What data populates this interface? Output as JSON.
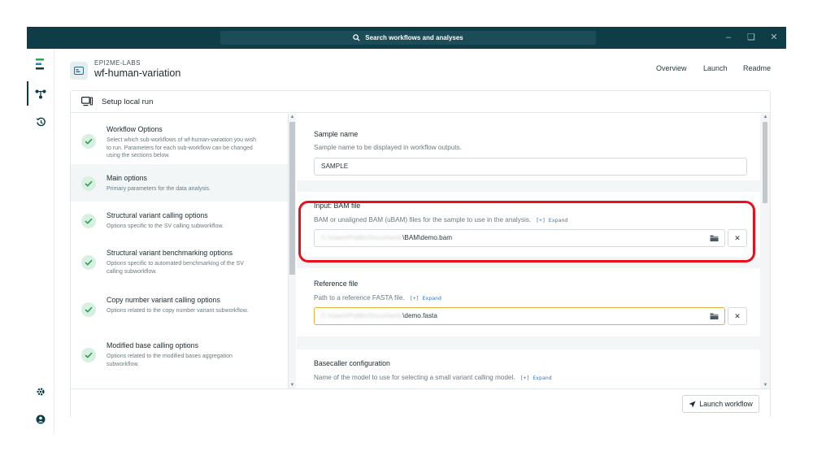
{
  "titlebar": {
    "search_placeholder": "Search workflows and analyses"
  },
  "header": {
    "brand": "EPI2ME-LABS",
    "title": "wf-human-variation",
    "nav": [
      "Overview",
      "Launch",
      "Readme"
    ]
  },
  "card": {
    "title": "Setup local run"
  },
  "steps": [
    {
      "title": "Workflow Options",
      "desc": "Select which sub-workflows of wf-human-variation you wish to run. Parameters for each sub-workflow can be changed using the sections below."
    },
    {
      "title": "Main options",
      "desc": "Primary parameters for the data analysis."
    },
    {
      "title": "Structural variant calling options",
      "desc": "Options specific to the SV calling subworkflow."
    },
    {
      "title": "Structural variant benchmarking options",
      "desc": "Options specific to automated benchmarking of the SV calling subworkflow."
    },
    {
      "title": "Copy number variant calling options",
      "desc": "Options related to the copy number variant subworkflow."
    },
    {
      "title": "Modified base calling options",
      "desc": "Options related to the modified bases aggregation subworkflow."
    }
  ],
  "form": {
    "sample_name": {
      "label": "Sample name",
      "desc": "Sample name to be displayed in workflow outputs.",
      "value": "SAMPLE"
    },
    "bam": {
      "label": "Input: BAM file",
      "desc": "BAM or unaligned BAM (uBAM) files for the sample to use in the analysis.",
      "expand": "[+] Expand",
      "value_hidden": "C:\\Users\\Public\\Documents",
      "value_visible": "\\BAM\\demo.bam"
    },
    "reference": {
      "label": "Reference file",
      "desc": "Path to a reference FASTA file.",
      "expand": "[+] Expand",
      "value_hidden": "C:\\Users\\Public\\Documents",
      "value_visible": "\\demo.fasta"
    },
    "basecaller": {
      "label": "Basecaller configuration",
      "desc": "Name of the model to use for selecting a small variant calling model.",
      "expand": "[+] Expand"
    }
  },
  "footer": {
    "launch_label": "Launch workflow"
  },
  "colors": {
    "titlebar": "#0e3d48",
    "accent_check": "#2f9e55",
    "highlight": "#e8101c",
    "focus": "#e0b23c"
  }
}
